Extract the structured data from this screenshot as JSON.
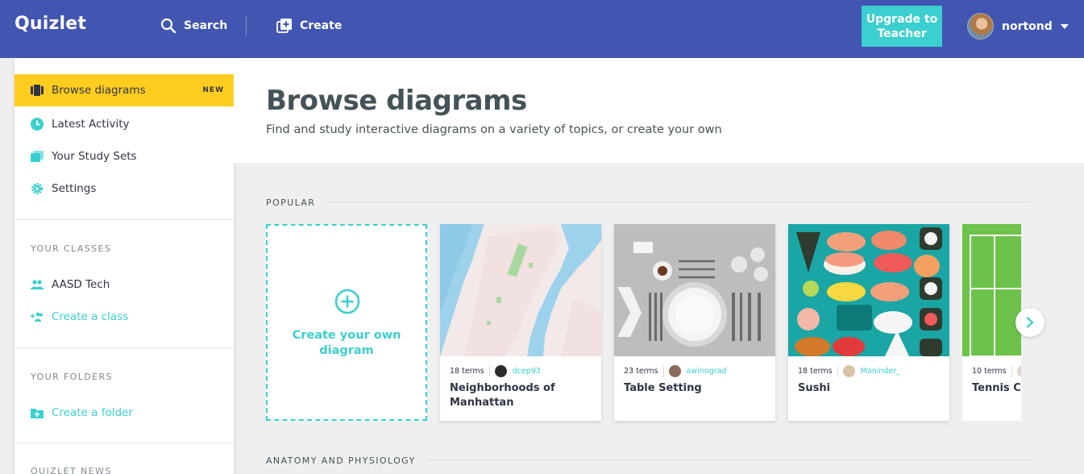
{
  "header": {
    "logo": "Quizlet",
    "search_label": "Search",
    "create_label": "Create",
    "upgrade_label": "Upgrade to Teacher",
    "username": "nortond"
  },
  "sidebar": {
    "nav": [
      {
        "label": "Browse diagrams",
        "icon": "diagram-icon",
        "badge": "NEW",
        "active": true
      },
      {
        "label": "Latest Activity",
        "icon": "clock-icon"
      },
      {
        "label": "Your Study Sets",
        "icon": "study-sets-icon"
      },
      {
        "label": "Settings",
        "icon": "gear-icon"
      }
    ],
    "classes_heading": "YOUR CLASSES",
    "classes": [
      {
        "label": "AASD Tech",
        "icon": "people-icon"
      },
      {
        "label": "Create a class",
        "icon": "add-people-icon"
      }
    ],
    "folders_heading": "YOUR FOLDERS",
    "create_folder": "Create a folder",
    "news_heading": "QUIZLET NEWS"
  },
  "main": {
    "title": "Browse diagrams",
    "subtitle": "Find and study interactive diagrams on a variety of topics, or create your own",
    "popular_heading": "POPULAR",
    "create_card_label": "Create your own diagram",
    "cards": [
      {
        "terms": "18 terms",
        "user": "dcep93",
        "title": "Neighborhoods of Manhattan"
      },
      {
        "terms": "23 terms",
        "user": "awinograd",
        "title": "Table Setting"
      },
      {
        "terms": "18 terms",
        "user": "Maninder_",
        "title": "Sushi"
      },
      {
        "terms": "10 terms",
        "user": "",
        "title": "Tennis Co"
      }
    ],
    "anatomy_heading": "ANATOMY AND PHYSIOLOGY"
  },
  "colors": {
    "header_bg": "#4255b1",
    "accent_teal": "#3ccfcf",
    "active_yellow": "#ffcd1f"
  }
}
